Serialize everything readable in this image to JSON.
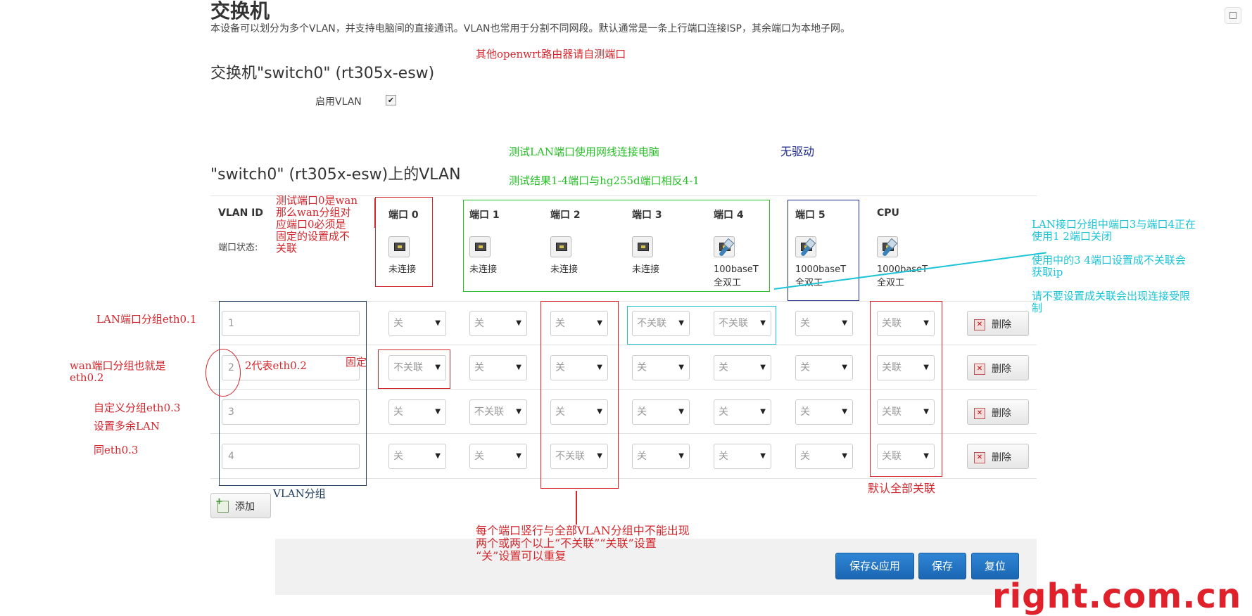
{
  "page": {
    "title": "交换机",
    "description": "本设备可以划分为多个VLAN，并支持电脑间的直接通讯。VLAN也常用于分割不同网段。默认通常是一条上行端口连接ISP，其余端口为本地子网。",
    "switch_title": "交换机\"switch0\" (rt305x-esw)",
    "enable_vlan_label": "启用VLAN",
    "enable_vlan_checked": "✔",
    "vlan_section_title": "\"switch0\" (rt305x-esw)上的VLAN"
  },
  "table": {
    "vlan_id_header": "VLAN ID",
    "port_status_label": "端口状态:",
    "ports": [
      {
        "name": "端口 0",
        "status1": "未连接",
        "status2": "",
        "icon": "port-unplugged-icon"
      },
      {
        "name": "端口 1",
        "status1": "未连接",
        "status2": "",
        "icon": "port-unplugged-icon"
      },
      {
        "name": "端口 2",
        "status1": "未连接",
        "status2": "",
        "icon": "port-unplugged-icon"
      },
      {
        "name": "端口 3",
        "status1": "未连接",
        "status2": "",
        "icon": "port-unplugged-icon"
      },
      {
        "name": "端口 4",
        "status1": "100baseT",
        "status2": "全双工",
        "icon": "port-plugged-icon"
      },
      {
        "name": "端口 5",
        "status1": "1000baseT",
        "status2": "全双工",
        "icon": "port-plugged-icon"
      },
      {
        "name": "CPU",
        "status1": "1000baseT",
        "status2": "全双工",
        "icon": "port-plugged-icon"
      }
    ],
    "rows": [
      {
        "vlan_id": "1",
        "values": [
          "关",
          "关",
          "关",
          "不关联",
          "不关联",
          "关",
          "关联"
        ],
        "delete_label": "删除"
      },
      {
        "vlan_id": "2",
        "values": [
          "不关联",
          "关",
          "关",
          "关",
          "关",
          "关",
          "关联"
        ],
        "delete_label": "删除"
      },
      {
        "vlan_id": "3",
        "values": [
          "关",
          "不关联",
          "关",
          "关",
          "关",
          "关",
          "关联"
        ],
        "delete_label": "删除"
      },
      {
        "vlan_id": "4",
        "values": [
          "关",
          "关",
          "不关联",
          "关",
          "关",
          "关",
          "关联"
        ],
        "delete_label": "删除"
      }
    ],
    "add_label": "添加"
  },
  "footer": {
    "save_apply_label": "保存&应用",
    "save_label": "保存",
    "reset_label": "复位"
  },
  "annotations": {
    "other_router": "其他openwrt路由器请自测端口",
    "test_lan_1": "测试LAN端口使用网线连接电脑",
    "test_lan_2": "测试结果1-4端口与hg255d端口相反4-1",
    "no_driver": "无驱动",
    "port0_note": [
      "测试端口0是wan",
      "那么wan分组对",
      "应端口0必须是",
      "固定的设置成不",
      "关联"
    ],
    "lan_note": [
      "LAN接口分组中端口3与端口4正在",
      "使用1 2端口关闭",
      "",
      "使用中的3 4端口设置成不关联会",
      "获取ip",
      "",
      "请不要设置成关联会出现连接受限",
      "制"
    ],
    "lan_group": "LAN端口分组eth0.1",
    "wan_group": [
      "wan端口分组也就是",
      "eth0.2"
    ],
    "represents": "2代表eth0.2",
    "fixed": "固定",
    "custom_group": [
      "自定义分组eth0.3",
      "设置多余LAN"
    ],
    "same_as": "同eth0.3",
    "vlan_group": "VLAN分组",
    "default_all": "默认全部关联",
    "bottom_note": [
      "每个端口竖行与全部VLAN分组中不能出现",
      "两个或两个以上“不关联”“关联”设置",
      "“关”设置可以重复"
    ],
    "watermark": "right.com.cn"
  },
  "colors": {
    "annotation_red": "#d3262c",
    "annotation_green": "#26c026",
    "annotation_cyan": "#1cc4d6",
    "annotation_navy": "#1f2a8a",
    "button_blue": "#1f73c4",
    "watermark_red": "#e0202a"
  }
}
